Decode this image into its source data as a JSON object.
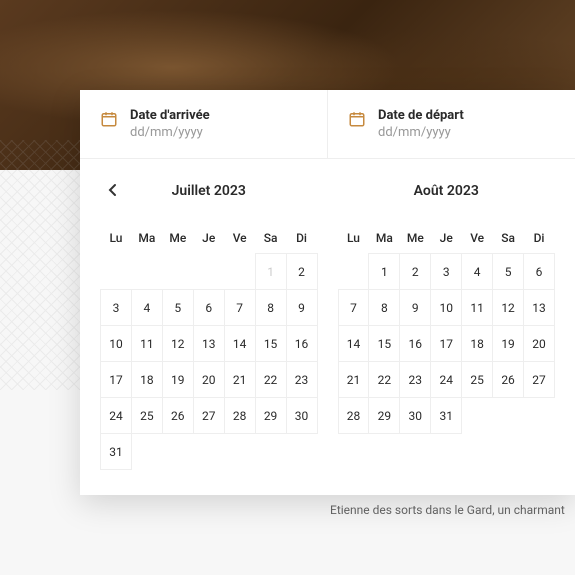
{
  "inputs": {
    "arrival": {
      "label": "Date d'arrivée",
      "placeholder": "dd/mm/yyyy"
    },
    "departure": {
      "label": "Date de départ",
      "placeholder": "dd/mm/yyyy"
    }
  },
  "calendars": {
    "weekdays": [
      "Lu",
      "Ma",
      "Me",
      "Je",
      "Ve",
      "Sa",
      "Di"
    ],
    "month1": {
      "title": "Juillet 2023",
      "startOffset": 5,
      "daysInMonth": 31,
      "disabled": [
        1
      ]
    },
    "month2": {
      "title": "Août 2023",
      "startOffset": 1,
      "daysInMonth": 31,
      "disabled": []
    }
  },
  "description": "Etienne des sorts dans le Gard, un charmant",
  "colors": {
    "accent": "#c68a3f"
  }
}
